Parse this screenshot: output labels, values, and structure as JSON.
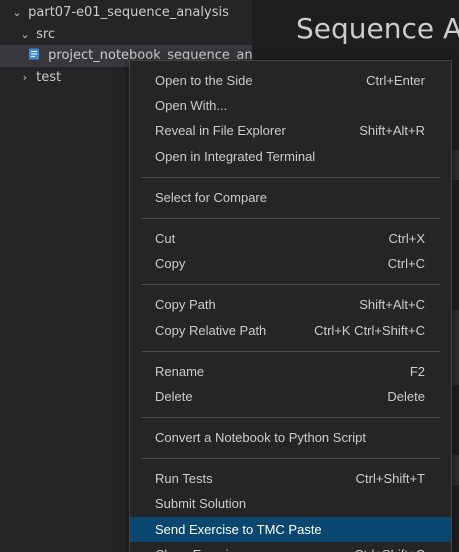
{
  "explorer": {
    "root_folder": "part07-e01_sequence_analysis",
    "src_folder": "src",
    "file_name": "project_notebook_sequence_analy...",
    "test_folder": "test"
  },
  "editor": {
    "title": "Sequence An"
  },
  "menu": {
    "items": [
      {
        "label": "Open to the Side",
        "shortcut": "Ctrl+Enter"
      },
      {
        "label": "Open With...",
        "shortcut": ""
      },
      {
        "label": "Reveal in File Explorer",
        "shortcut": "Shift+Alt+R"
      },
      {
        "label": "Open in Integrated Terminal",
        "shortcut": ""
      },
      {
        "label": "Select for Compare",
        "shortcut": ""
      },
      {
        "label": "Cut",
        "shortcut": "Ctrl+X"
      },
      {
        "label": "Copy",
        "shortcut": "Ctrl+C"
      },
      {
        "label": "Copy Path",
        "shortcut": "Shift+Alt+C"
      },
      {
        "label": "Copy Relative Path",
        "shortcut": "Ctrl+K Ctrl+Shift+C"
      },
      {
        "label": "Rename",
        "shortcut": "F2"
      },
      {
        "label": "Delete",
        "shortcut": "Delete"
      },
      {
        "label": "Convert a Notebook to Python Script",
        "shortcut": ""
      },
      {
        "label": "Run Tests",
        "shortcut": "Ctrl+Shift+T"
      },
      {
        "label": "Submit Solution",
        "shortcut": ""
      },
      {
        "label": "Send Exercise to TMC Paste",
        "shortcut": ""
      },
      {
        "label": "Clean Exercise",
        "shortcut": "Ctrl+Shift+C"
      }
    ]
  },
  "colors": {
    "menu_highlight": "#094771",
    "sidebar_bg": "#252526",
    "editor_bg": "#1e1e1e"
  }
}
